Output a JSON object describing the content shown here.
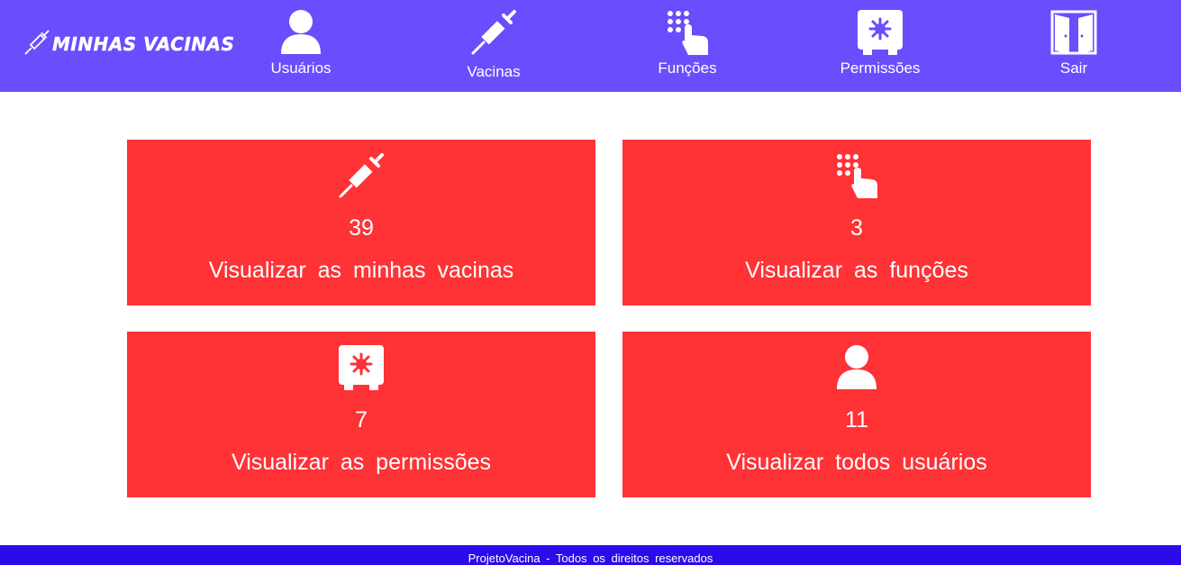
{
  "header": {
    "brand": "Minhas Vacinas",
    "nav": [
      {
        "label": "Usuários",
        "icon": "user-icon"
      },
      {
        "label": "Vacinas",
        "icon": "syringe-icon"
      },
      {
        "label": "Funções",
        "icon": "touch-keypad-icon"
      },
      {
        "label": "Permissões",
        "icon": "safe-icon"
      },
      {
        "label": "Sair",
        "icon": "door-icon"
      }
    ]
  },
  "cards": [
    {
      "count": "39",
      "label": "Visualizar as minhas vacinas",
      "icon": "syringe-icon"
    },
    {
      "count": "3",
      "label": "Visualizar as funções",
      "icon": "touch-keypad-icon"
    },
    {
      "count": "7",
      "label": "Visualizar as permissões",
      "icon": "safe-icon"
    },
    {
      "count": "11",
      "label": "Visualizar todos usuários",
      "icon": "user-icon"
    }
  ],
  "footer": {
    "text": "ProjetoVacina - Todos os direitos reservados"
  },
  "colors": {
    "header": "#6a4dfd",
    "card": "#ff3236",
    "footer": "#2a0bea"
  }
}
